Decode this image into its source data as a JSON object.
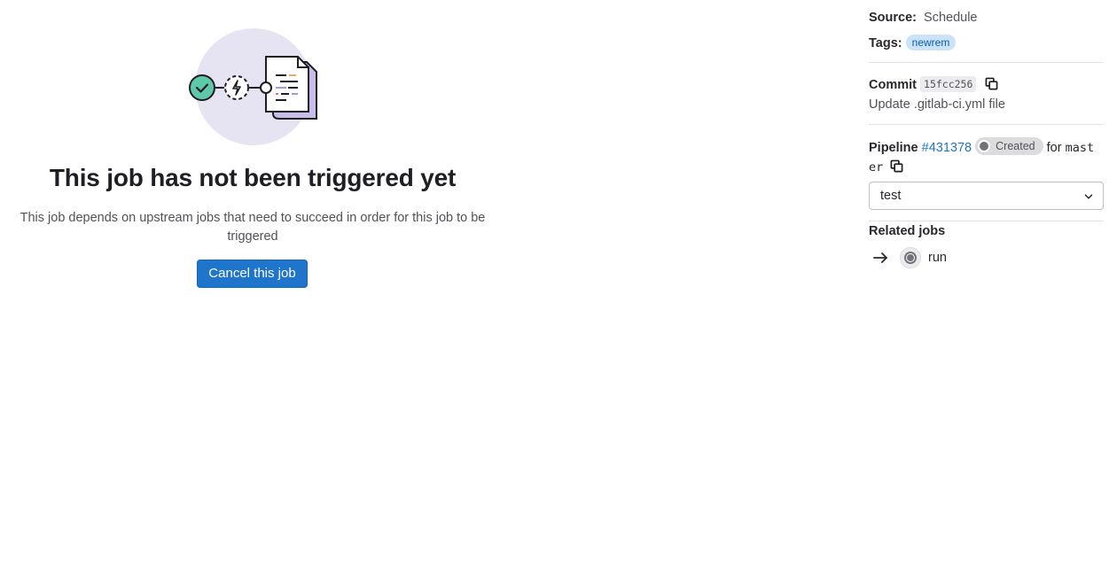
{
  "empty_state": {
    "title": "This job has not been triggered yet",
    "description": "This job depends on upstream jobs that need to succeed in order for this job to be triggered",
    "cancel_button": "Cancel this job",
    "illustration_icon": "pipeline-waiting-illustration"
  },
  "sidebar": {
    "source_label": "Source:",
    "source_value": "Schedule",
    "tags_label": "Tags:",
    "tags": [
      "newrem"
    ],
    "commit_label": "Commit",
    "commit_sha": "15fcc256",
    "commit_message": "Update .gitlab-ci.yml file",
    "pipeline_label": "Pipeline",
    "pipeline_id": "#431378",
    "pipeline_status": "Created",
    "for_text": "for",
    "ref_part1": "mast",
    "ref_part2": "er",
    "stage": "test",
    "related_jobs_title": "Related jobs",
    "related_jobs": [
      {
        "name": "run",
        "status": "created"
      }
    ]
  },
  "colors": {
    "primary_button": "#1f75cb",
    "link": "#1f75cb",
    "tag_bg": "#cbe2f9",
    "tag_text": "#0b5cad",
    "status_created": "#737278"
  }
}
